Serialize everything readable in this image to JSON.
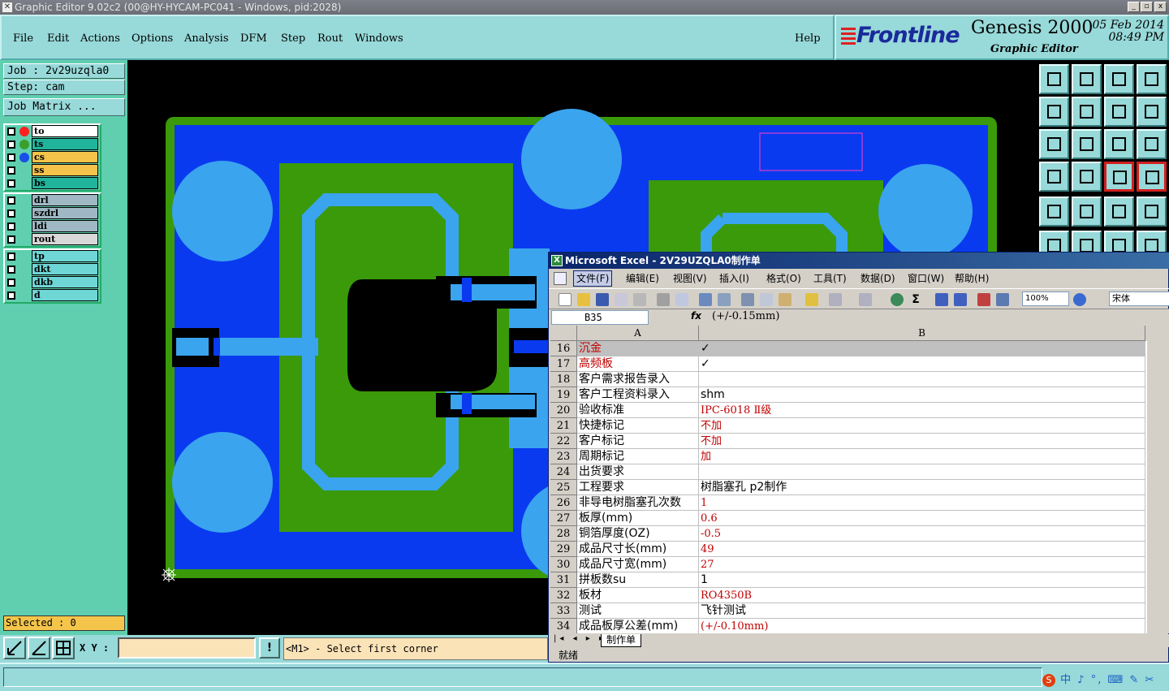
{
  "window": {
    "title": "Graphic Editor 9.02c2 (00@HY-HYCAM-PC041 - Windows, pid:2028)"
  },
  "menu": {
    "items": [
      "File",
      "Edit",
      "Actions",
      "Options",
      "Analysis",
      "DFM",
      "Step",
      "Rout",
      "Windows"
    ],
    "help": "Help"
  },
  "brand": {
    "logo": "Frontline",
    "product": "Genesis 2000",
    "subtitle": "Graphic Editor",
    "date": "05 Feb 2014",
    "time": "08:49  PM"
  },
  "left": {
    "job": "Job : 2v29uzqla0",
    "step": "Step: cam",
    "job_matrix": "Job Matrix ...",
    "layers_group1": [
      {
        "name": "to",
        "dot": "#ff2020",
        "bg": "#ffffff"
      },
      {
        "name": "ts",
        "dot": "#3aa02a",
        "bg": "#20b49c"
      },
      {
        "name": "cs",
        "dot": "#1a4ee8",
        "bg": "#f5c24a"
      },
      {
        "name": "ss",
        "dot": "",
        "bg": "#f5c24a"
      },
      {
        "name": "bs",
        "dot": "",
        "bg": "#20b49c"
      }
    ],
    "layers_group2": [
      {
        "name": "drl",
        "bg": "#9fb8c4"
      },
      {
        "name": "szdrl",
        "bg": "#9fb8c4"
      },
      {
        "name": "ldi",
        "bg": "#9fb8c4"
      },
      {
        "name": "rout",
        "bg": "#d8d8d8"
      }
    ],
    "layers_group3": [
      {
        "name": "tp",
        "bg": "#6fd6d6"
      },
      {
        "name": "dkt",
        "bg": "#6fd6d6"
      },
      {
        "name": "dkb",
        "bg": "#6fd6d6"
      },
      {
        "name": "d",
        "bg": "#6fd6d6"
      }
    ],
    "selected": "Selected : 0"
  },
  "tools": [
    "snap-up-icon",
    "snap-down-icon",
    "home-icon",
    "window-icon",
    "move-left-icon",
    "move-right-icon",
    "swap-icon",
    "layers-icon",
    "fit-vertical-icon",
    "fit-center-icon",
    "scale-one-to-two-icon",
    "help-icon",
    "measure-icon",
    "grid-icon",
    "feature-select-red-icon",
    "feature-select-red2-icon",
    "pad-icon",
    "shape-edit-icon",
    "ruler-icon",
    "circle-select-icon",
    "net-icon",
    "cross-icon",
    "line-up-icon",
    "line-diag-icon"
  ],
  "bottom": {
    "xy_label": "X Y :",
    "xy_value": "",
    "excl": "!",
    "message": "<M1> - Select first corner"
  },
  "excel": {
    "title": "Microsoft Excel - 2V29UZQLA0制作单",
    "menu": [
      "文件(F)",
      "编辑(E)",
      "视图(V)",
      "插入(I)",
      "格式(O)",
      "工具(T)",
      "数据(D)",
      "窗口(W)",
      "帮助(H)"
    ],
    "zoom": "100%",
    "font": "宋体",
    "cell_ref": "B35",
    "fx": "fx",
    "formula": "(+/-0.15mm)",
    "col_a": "A",
    "col_b": "B",
    "rows": [
      {
        "n": "16",
        "a": "沉金",
        "b": "✓",
        "a_red": true,
        "b_black": true,
        "sel": true
      },
      {
        "n": "17",
        "a": "高频板",
        "b": "✓",
        "a_red": true,
        "b_black": true
      },
      {
        "n": "18",
        "a": "客户需求报告录入",
        "b": ""
      },
      {
        "n": "19",
        "a": "客户工程资料录入",
        "b": "shm",
        "b_black": true
      },
      {
        "n": "20",
        "a": "验收标准",
        "b": "IPC-6018 Ⅱ级"
      },
      {
        "n": "21",
        "a": "快捷标记",
        "b": "不加"
      },
      {
        "n": "22",
        "a": "客户标记",
        "b": "不加"
      },
      {
        "n": "23",
        "a": "周期标记",
        "b": "加"
      },
      {
        "n": "24",
        "a": "出货要求",
        "b": ""
      },
      {
        "n": "25",
        "a": "工程要求",
        "b": "树脂塞孔 p2制作",
        "b_black": true
      },
      {
        "n": "26",
        "a": "非导电树脂塞孔次数",
        "b": "1"
      },
      {
        "n": "27",
        "a": "板厚(mm)",
        "b": "0.6"
      },
      {
        "n": "28",
        "a": "铜箔厚度(OZ)",
        "b": "-0.5"
      },
      {
        "n": "29",
        "a": "成品尺寸长(mm)",
        "b": "49"
      },
      {
        "n": "30",
        "a": "成品尺寸宽(mm)",
        "b": "27"
      },
      {
        "n": "31",
        "a": "拼板数su",
        "b": "1",
        "b_black": true
      },
      {
        "n": "32",
        "a": "板材",
        "b": "RO4350B"
      },
      {
        "n": "33",
        "a": "测试",
        "b": "飞针测试",
        "b_black": true
      },
      {
        "n": "34",
        "a": "成品板厚公差(mm)",
        "b": "(+/-0.10mm)"
      }
    ],
    "sheet_tab": "制作单",
    "status": "就绪"
  },
  "ime": "中 ♪ °, ⌨ ✎ ✂",
  "colors": {
    "pcb_green": "#3a9a0a",
    "pcb_blue": "#0a3af0",
    "pad_light_blue": "#3aa4ef",
    "panel_cyan": "#98d9d9",
    "panel_green": "#5fcfaf"
  }
}
